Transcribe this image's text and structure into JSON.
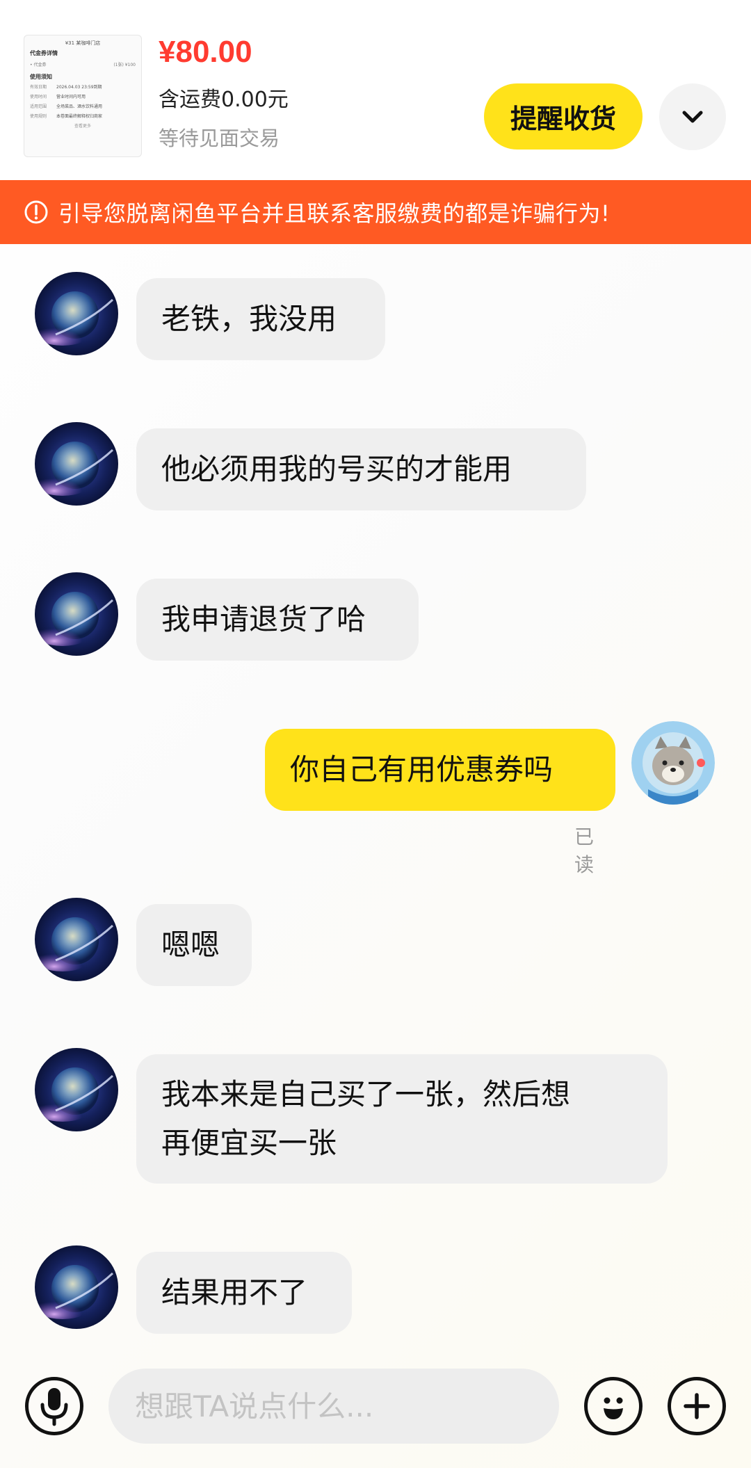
{
  "order": {
    "price": "¥80.00",
    "shipping": "含运费0.00元",
    "status": "等待见面交易",
    "remind_button": "提醒收货",
    "thumbnail": {
      "top": "¥31 某咖啡门店",
      "title": "代金券详情",
      "row_left": "• 代金券",
      "row_right": "(1张)  ¥100",
      "section": "使用须知",
      "lines": [
        {
          "k": "有效日期",
          "v": "2026.04.03 23:59到期"
        },
        {
          "k": "使用时间",
          "v": "营业时间内可用"
        },
        {
          "k": "适用范围",
          "v": "全场菜品、酒水饮料通用"
        },
        {
          "k": "使用规则",
          "v": "本卷面最终解释权归商家"
        }
      ],
      "more": "查看更多"
    }
  },
  "warning": {
    "text": "引导您脱离闲鱼平台并且联系客服缴费的都是诈骗行为!"
  },
  "messages": [
    {
      "side": "in",
      "text": "老铁，我没用"
    },
    {
      "side": "in",
      "text": "他必须用我的号买的才能用"
    },
    {
      "side": "in",
      "text": "我申请退货了哈"
    },
    {
      "side": "out",
      "text": "你自己有用优惠券吗",
      "read_label": "已读"
    },
    {
      "side": "in",
      "text": "嗯嗯"
    },
    {
      "side": "in",
      "line1": "我本来是自己买了一张，然后想",
      "line2": "再便宜买一张"
    },
    {
      "side": "in",
      "text": "结果用不了"
    }
  ],
  "input": {
    "placeholder": "想跟TA说点什么..."
  },
  "icons": {
    "expand": "chevron-down-icon",
    "voice": "microphone-icon",
    "emoji": "emoji-icon",
    "more": "plus-icon",
    "warning": "alert-circle-icon"
  },
  "colors": {
    "price": "#ff3b30",
    "accent_yellow": "#ffe21a",
    "warning_bg": "#ff5a23",
    "incoming_bubble": "#efefef"
  }
}
